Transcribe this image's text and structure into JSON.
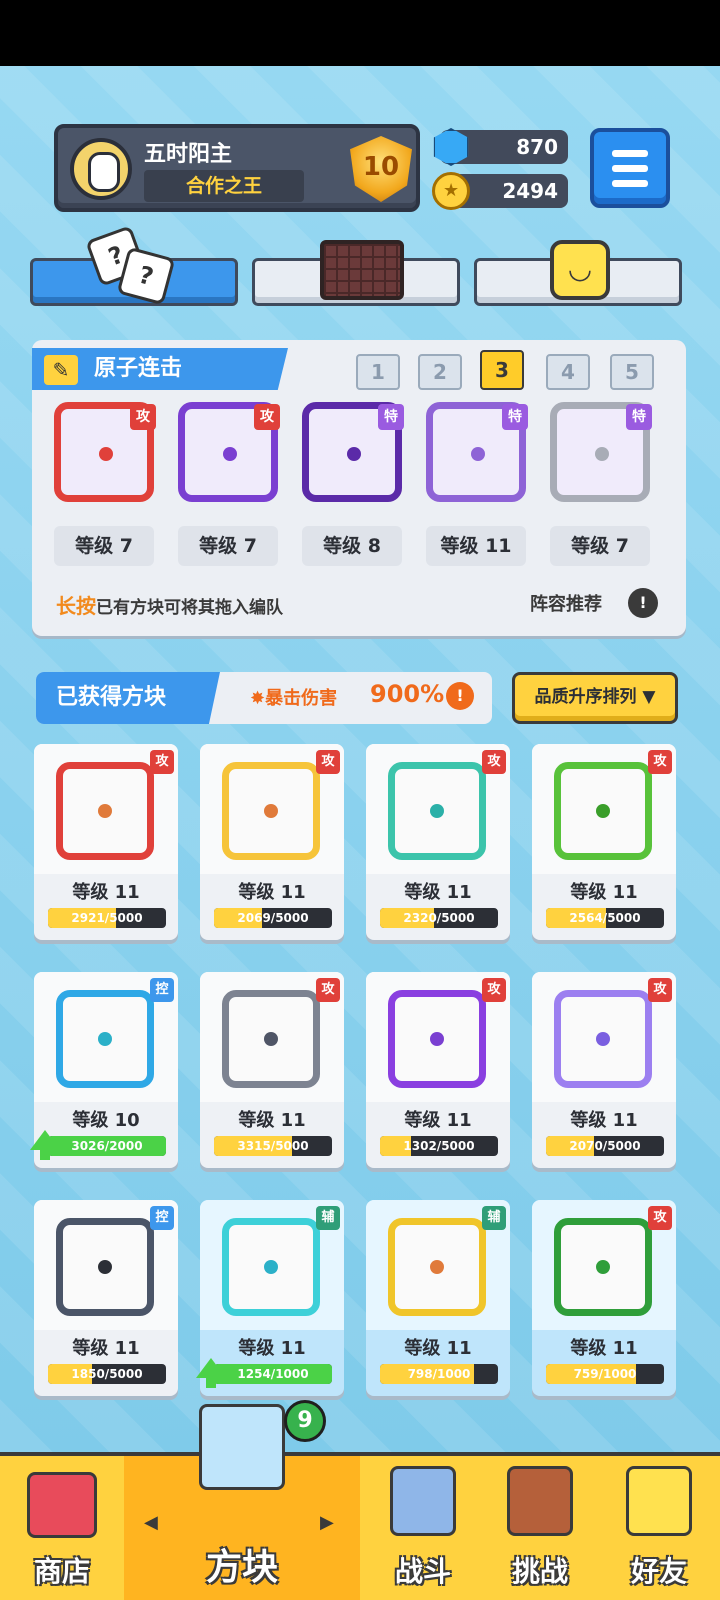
{
  "profile": {
    "name": "五时阳主",
    "title": "合作之王",
    "rank": "10"
  },
  "currency": {
    "gems": "870",
    "coins": "2494"
  },
  "deck": {
    "title": "原子连击",
    "tabs": [
      "1",
      "2",
      "3",
      "4",
      "5"
    ],
    "active_tab": "3",
    "slots": [
      {
        "tag": "攻",
        "level": "等级 7",
        "color": "#e0403a"
      },
      {
        "tag": "攻",
        "level": "等级 7",
        "color": "#7a3fd1"
      },
      {
        "tag": "特",
        "level": "等级 8",
        "color": "#5b2aa8"
      },
      {
        "tag": "特",
        "level": "等级 11",
        "color": "#8e63d6"
      },
      {
        "tag": "特",
        "level": "等级 7",
        "color": "#a8acb6"
      }
    ],
    "hint_bold": "长按",
    "hint_text": "已有方块可将其拖入编队",
    "recommend": "阵容推荐"
  },
  "obtained": {
    "title": "已获得方块",
    "crit_label": "暴击伤害",
    "crit_value": "900%",
    "sort_label": "品质升序排列 ▼"
  },
  "cards": [
    {
      "tag": "攻",
      "level": "等级 11",
      "progress": "2921/5000",
      "frac": 0.58,
      "color": "#e0403a",
      "dot": "#e07a3a"
    },
    {
      "tag": "攻",
      "level": "等级 11",
      "progress": "2069/5000",
      "frac": 0.41,
      "color": "#f6c43a",
      "dot": "#e07a3a"
    },
    {
      "tag": "攻",
      "level": "等级 11",
      "progress": "2320/5000",
      "frac": 0.46,
      "color": "#3cc4ab",
      "dot": "#2bb0a8"
    },
    {
      "tag": "攻",
      "level": "等级 11",
      "progress": "2564/5000",
      "frac": 0.51,
      "color": "#58c23a",
      "dot": "#3a9e2a"
    },
    {
      "tag": "控",
      "level": "等级 10",
      "progress": "3026/2000",
      "frac": 1.0,
      "color": "#2fa8e6",
      "dot": "#2bb0c8",
      "upgrade": true
    },
    {
      "tag": "攻",
      "level": "等级 11",
      "progress": "3315/5000",
      "frac": 0.66,
      "color": "#7d8391",
      "dot": "#4f5566"
    },
    {
      "tag": "攻",
      "level": "等级 11",
      "progress": "1302/5000",
      "frac": 0.26,
      "color": "#8a3fe0",
      "dot": "#7a3fd1"
    },
    {
      "tag": "攻",
      "level": "等级 11",
      "progress": "2070/5000",
      "frac": 0.41,
      "color": "#9c7ff0",
      "dot": "#7a5fe0"
    },
    {
      "tag": "控",
      "level": "等级 11",
      "progress": "1850/5000",
      "frac": 0.37,
      "color": "#4b5568",
      "dot": "#2c2f36"
    },
    {
      "tag": "辅",
      "level": "等级 11",
      "progress": "1254/1000",
      "frac": 1.0,
      "color": "#3dd0d8",
      "dot": "#2bb0c8",
      "upgrade": true,
      "hl": true
    },
    {
      "tag": "辅",
      "level": "等级 11",
      "progress": "798/1000",
      "frac": 0.8,
      "color": "#f0c52a",
      "dot": "#e07a3a",
      "hl": true
    },
    {
      "tag": "攻",
      "level": "等级 11",
      "progress": "759/1000",
      "frac": 0.76,
      "color": "#2f9e3a",
      "dot": "#2f9e3a",
      "hl": true
    }
  ],
  "nav": {
    "shop": "商店",
    "blocks": "方块",
    "battle": "战斗",
    "challenge": "挑战",
    "friends": "好友",
    "badge": "9"
  }
}
